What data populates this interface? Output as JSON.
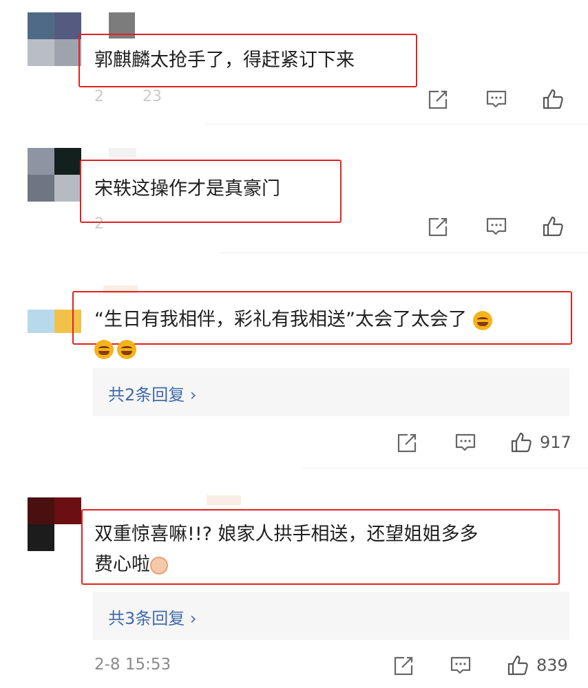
{
  "comments": [
    {
      "text": "郭麒麟太抢手了，得赶紧订下来",
      "meta_partial": "2        23",
      "avatar_colors": [
        "#4f6a86",
        "#545a80",
        "#b9bdc6",
        "#9fa3ad"
      ]
    },
    {
      "text": "宋轶这操作才是真豪门",
      "meta_partial": "2",
      "avatar_colors": [
        "#8d95a2",
        "#14201e",
        "#6e7684",
        "#b5bac3"
      ]
    },
    {
      "text_line1": "“生日有我相伴，彩礼有我相送”太会了太会了",
      "emoji_names": [
        "grin-emoji",
        "grin-emoji",
        "grin-emoji"
      ],
      "replies_label": "共2条回复",
      "likes": "917",
      "avatar_colors": [
        "#b8d9ec",
        "#f2c14a"
      ]
    },
    {
      "text_line1": "双重惊喜嘛!!? 娘家人拱手相送，还望姐姐多多",
      "text_line2": "费心啦",
      "emoji_names": [
        "blush-emoji"
      ],
      "replies_label": "共3条回复",
      "likes": "839",
      "timestamp": "2-8 15:53",
      "avatar_colors": [
        "#4a1010",
        "#6b0f12",
        "#1c1c1c",
        "#ffffff"
      ]
    }
  ],
  "icons": {
    "share": "share-icon",
    "comment": "comment-icon",
    "like": "thumbs-up-icon"
  },
  "colors": {
    "highlight_border": "#e0221f",
    "reply_link": "#3f6aa8",
    "reply_bg": "#f6f6f6",
    "meta_text": "#8a8a8a"
  }
}
